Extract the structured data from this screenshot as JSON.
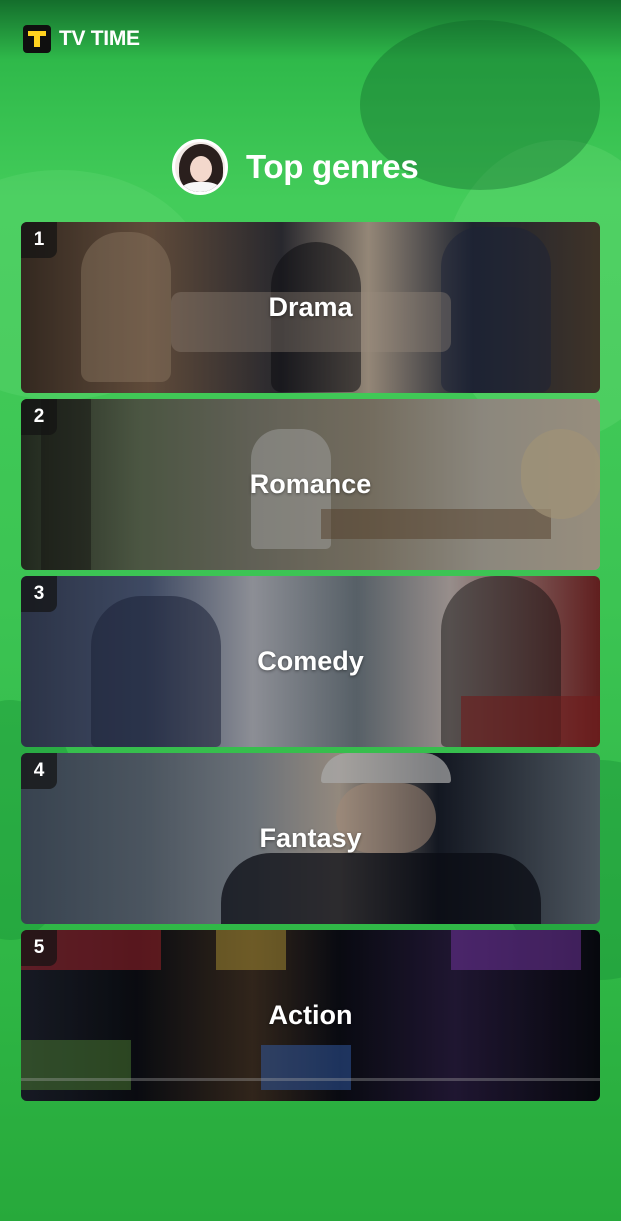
{
  "brand": {
    "name": "TV TIME",
    "icon": "tv-time-logo-icon"
  },
  "header": {
    "title": "Top genres",
    "avatar": "user-avatar"
  },
  "genres": [
    {
      "rank": "1",
      "name": "Drama"
    },
    {
      "rank": "2",
      "name": "Romance"
    },
    {
      "rank": "3",
      "name": "Comedy"
    },
    {
      "rank": "4",
      "name": "Fantasy"
    },
    {
      "rank": "5",
      "name": "Action"
    }
  ],
  "colors": {
    "background": "#3cc453",
    "logo_accent": "#ffd21f",
    "logo_bg": "#0f0f0f",
    "text": "#ffffff"
  }
}
